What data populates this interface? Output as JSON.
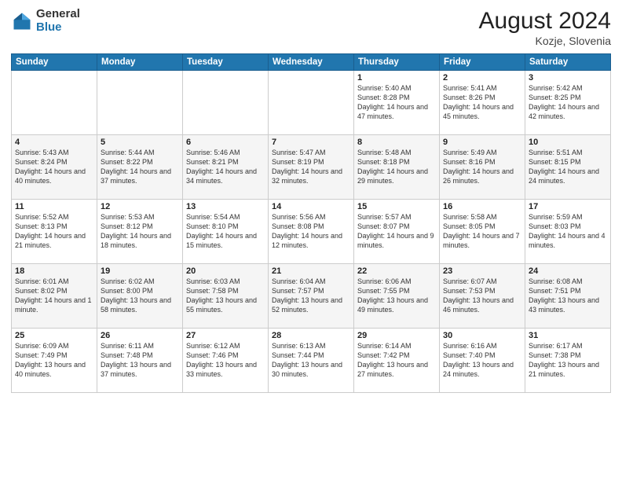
{
  "logo": {
    "general": "General",
    "blue": "Blue"
  },
  "header": {
    "month_year": "August 2024",
    "location": "Kozje, Slovenia"
  },
  "days_of_week": [
    "Sunday",
    "Monday",
    "Tuesday",
    "Wednesday",
    "Thursday",
    "Friday",
    "Saturday"
  ],
  "weeks": [
    [
      {
        "day": "",
        "content": ""
      },
      {
        "day": "",
        "content": ""
      },
      {
        "day": "",
        "content": ""
      },
      {
        "day": "",
        "content": ""
      },
      {
        "day": "1",
        "content": "Sunrise: 5:40 AM\nSunset: 8:28 PM\nDaylight: 14 hours\nand 47 minutes."
      },
      {
        "day": "2",
        "content": "Sunrise: 5:41 AM\nSunset: 8:26 PM\nDaylight: 14 hours\nand 45 minutes."
      },
      {
        "day": "3",
        "content": "Sunrise: 5:42 AM\nSunset: 8:25 PM\nDaylight: 14 hours\nand 42 minutes."
      }
    ],
    [
      {
        "day": "4",
        "content": "Sunrise: 5:43 AM\nSunset: 8:24 PM\nDaylight: 14 hours\nand 40 minutes."
      },
      {
        "day": "5",
        "content": "Sunrise: 5:44 AM\nSunset: 8:22 PM\nDaylight: 14 hours\nand 37 minutes."
      },
      {
        "day": "6",
        "content": "Sunrise: 5:46 AM\nSunset: 8:21 PM\nDaylight: 14 hours\nand 34 minutes."
      },
      {
        "day": "7",
        "content": "Sunrise: 5:47 AM\nSunset: 8:19 PM\nDaylight: 14 hours\nand 32 minutes."
      },
      {
        "day": "8",
        "content": "Sunrise: 5:48 AM\nSunset: 8:18 PM\nDaylight: 14 hours\nand 29 minutes."
      },
      {
        "day": "9",
        "content": "Sunrise: 5:49 AM\nSunset: 8:16 PM\nDaylight: 14 hours\nand 26 minutes."
      },
      {
        "day": "10",
        "content": "Sunrise: 5:51 AM\nSunset: 8:15 PM\nDaylight: 14 hours\nand 24 minutes."
      }
    ],
    [
      {
        "day": "11",
        "content": "Sunrise: 5:52 AM\nSunset: 8:13 PM\nDaylight: 14 hours\nand 21 minutes."
      },
      {
        "day": "12",
        "content": "Sunrise: 5:53 AM\nSunset: 8:12 PM\nDaylight: 14 hours\nand 18 minutes."
      },
      {
        "day": "13",
        "content": "Sunrise: 5:54 AM\nSunset: 8:10 PM\nDaylight: 14 hours\nand 15 minutes."
      },
      {
        "day": "14",
        "content": "Sunrise: 5:56 AM\nSunset: 8:08 PM\nDaylight: 14 hours\nand 12 minutes."
      },
      {
        "day": "15",
        "content": "Sunrise: 5:57 AM\nSunset: 8:07 PM\nDaylight: 14 hours\nand 9 minutes."
      },
      {
        "day": "16",
        "content": "Sunrise: 5:58 AM\nSunset: 8:05 PM\nDaylight: 14 hours\nand 7 minutes."
      },
      {
        "day": "17",
        "content": "Sunrise: 5:59 AM\nSunset: 8:03 PM\nDaylight: 14 hours\nand 4 minutes."
      }
    ],
    [
      {
        "day": "18",
        "content": "Sunrise: 6:01 AM\nSunset: 8:02 PM\nDaylight: 14 hours\nand 1 minute."
      },
      {
        "day": "19",
        "content": "Sunrise: 6:02 AM\nSunset: 8:00 PM\nDaylight: 13 hours\nand 58 minutes."
      },
      {
        "day": "20",
        "content": "Sunrise: 6:03 AM\nSunset: 7:58 PM\nDaylight: 13 hours\nand 55 minutes."
      },
      {
        "day": "21",
        "content": "Sunrise: 6:04 AM\nSunset: 7:57 PM\nDaylight: 13 hours\nand 52 minutes."
      },
      {
        "day": "22",
        "content": "Sunrise: 6:06 AM\nSunset: 7:55 PM\nDaylight: 13 hours\nand 49 minutes."
      },
      {
        "day": "23",
        "content": "Sunrise: 6:07 AM\nSunset: 7:53 PM\nDaylight: 13 hours\nand 46 minutes."
      },
      {
        "day": "24",
        "content": "Sunrise: 6:08 AM\nSunset: 7:51 PM\nDaylight: 13 hours\nand 43 minutes."
      }
    ],
    [
      {
        "day": "25",
        "content": "Sunrise: 6:09 AM\nSunset: 7:49 PM\nDaylight: 13 hours\nand 40 minutes."
      },
      {
        "day": "26",
        "content": "Sunrise: 6:11 AM\nSunset: 7:48 PM\nDaylight: 13 hours\nand 37 minutes."
      },
      {
        "day": "27",
        "content": "Sunrise: 6:12 AM\nSunset: 7:46 PM\nDaylight: 13 hours\nand 33 minutes."
      },
      {
        "day": "28",
        "content": "Sunrise: 6:13 AM\nSunset: 7:44 PM\nDaylight: 13 hours\nand 30 minutes."
      },
      {
        "day": "29",
        "content": "Sunrise: 6:14 AM\nSunset: 7:42 PM\nDaylight: 13 hours\nand 27 minutes."
      },
      {
        "day": "30",
        "content": "Sunrise: 6:16 AM\nSunset: 7:40 PM\nDaylight: 13 hours\nand 24 minutes."
      },
      {
        "day": "31",
        "content": "Sunrise: 6:17 AM\nSunset: 7:38 PM\nDaylight: 13 hours\nand 21 minutes."
      }
    ]
  ]
}
